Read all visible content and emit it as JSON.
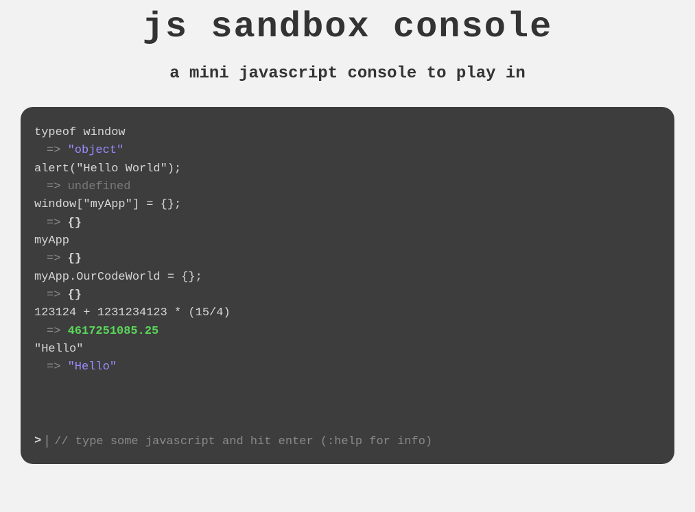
{
  "header": {
    "title": "js sandbox console",
    "subtitle": "a mini javascript console to play in"
  },
  "console": {
    "arrow": "=>",
    "prompt": ">",
    "history": [
      {
        "command": "typeof window",
        "result": "\"object\"",
        "resultType": "string"
      },
      {
        "command": "alert(\"Hello World\");",
        "result": "undefined",
        "resultType": "undefined"
      },
      {
        "command": "window[\"myApp\"] = {};",
        "result": "{}",
        "resultType": "object"
      },
      {
        "command": "myApp",
        "result": "{}",
        "resultType": "object"
      },
      {
        "command": "myApp.OurCodeWorld = {};",
        "result": "{}",
        "resultType": "object"
      },
      {
        "command": "123124 + 1231234123 * (15/4)",
        "result": "4617251085.25",
        "resultType": "number"
      },
      {
        "command": "\"Hello\"",
        "result": "\"Hello\"",
        "resultType": "string"
      }
    ],
    "input": {
      "value": "",
      "placeholder": "// type some javascript and hit enter (:help for info)"
    }
  }
}
